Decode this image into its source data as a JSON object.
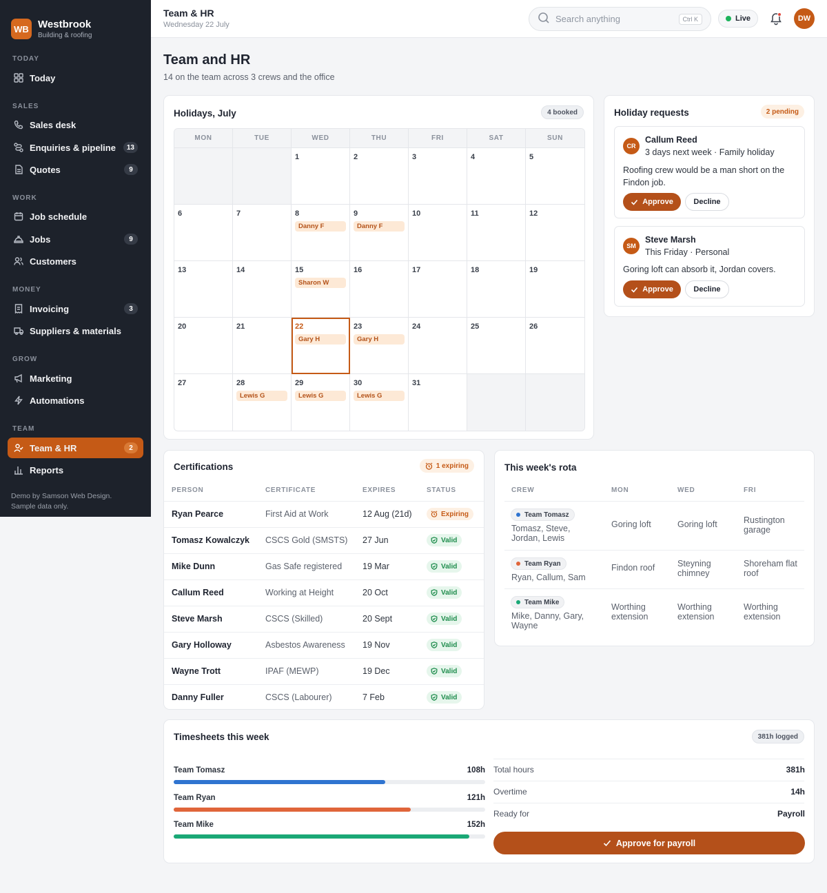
{
  "brand": {
    "logo": "WB",
    "name": "Westbrook",
    "subtitle": "Building & roofing"
  },
  "sidebar": {
    "sections": [
      "TODAY",
      "SALES",
      "WORK",
      "MONEY",
      "GROW",
      "TEAM"
    ],
    "items": [
      {
        "label": "Today",
        "icon": "grid-icon",
        "badge": ""
      },
      {
        "label": "Sales desk",
        "icon": "phone-icon",
        "badge": ""
      },
      {
        "label": "Enquiries & pipeline",
        "icon": "pipeline-icon",
        "badge": "13"
      },
      {
        "label": "Quotes",
        "icon": "document-icon",
        "badge": "9"
      },
      {
        "label": "Job schedule",
        "icon": "calendar-icon",
        "badge": ""
      },
      {
        "label": "Jobs",
        "icon": "hardhat-icon",
        "badge": "9"
      },
      {
        "label": "Customers",
        "icon": "users-icon",
        "badge": ""
      },
      {
        "label": "Invoicing",
        "icon": "receipt-icon",
        "badge": "3"
      },
      {
        "label": "Suppliers & materials",
        "icon": "truck-icon",
        "badge": ""
      },
      {
        "label": "Marketing",
        "icon": "megaphone-icon",
        "badge": ""
      },
      {
        "label": "Automations",
        "icon": "bolt-icon",
        "badge": ""
      },
      {
        "label": "Team & HR",
        "icon": "user-check-icon",
        "badge": "2"
      },
      {
        "label": "Reports",
        "icon": "bar-chart-icon",
        "badge": ""
      }
    ],
    "footer_line1": "Demo by Samson Web Design.",
    "footer_line2": "Sample data only."
  },
  "topbar": {
    "title": "Team & HR",
    "date": "Wednesday 22 July",
    "search_placeholder": "Search anything",
    "search_shortcut": "Ctrl K",
    "live_label": "Live",
    "avatar": "DW"
  },
  "page": {
    "title": "Team and HR",
    "subtitle": "14 on the team across 3 crews and the office"
  },
  "holidays": {
    "title": "Holidays, July",
    "badge": "4 booked",
    "weekdays": [
      "MON",
      "TUE",
      "WED",
      "THU",
      "FRI",
      "SAT",
      "SUN"
    ],
    "cells": [
      {
        "day": "",
        "events": []
      },
      {
        "day": "",
        "events": []
      },
      {
        "day": "1",
        "events": []
      },
      {
        "day": "2",
        "events": []
      },
      {
        "day": "3",
        "events": []
      },
      {
        "day": "4",
        "events": []
      },
      {
        "day": "5",
        "events": []
      },
      {
        "day": "6",
        "events": []
      },
      {
        "day": "7",
        "events": []
      },
      {
        "day": "8",
        "events": [
          "Danny F"
        ]
      },
      {
        "day": "9",
        "events": [
          "Danny F"
        ]
      },
      {
        "day": "10",
        "events": []
      },
      {
        "day": "11",
        "events": []
      },
      {
        "day": "12",
        "events": []
      },
      {
        "day": "13",
        "events": []
      },
      {
        "day": "14",
        "events": []
      },
      {
        "day": "15",
        "events": [
          "Sharon W"
        ]
      },
      {
        "day": "16",
        "events": []
      },
      {
        "day": "17",
        "events": []
      },
      {
        "day": "18",
        "events": []
      },
      {
        "day": "19",
        "events": []
      },
      {
        "day": "20",
        "events": []
      },
      {
        "day": "21",
        "events": []
      },
      {
        "day": "22",
        "events": [
          "Gary H"
        ],
        "today": true
      },
      {
        "day": "23",
        "events": [
          "Gary H"
        ]
      },
      {
        "day": "24",
        "events": []
      },
      {
        "day": "25",
        "events": []
      },
      {
        "day": "26",
        "events": []
      },
      {
        "day": "27",
        "events": []
      },
      {
        "day": "28",
        "events": [
          "Lewis G"
        ]
      },
      {
        "day": "29",
        "events": [
          "Lewis G"
        ]
      },
      {
        "day": "30",
        "events": [
          "Lewis G"
        ]
      },
      {
        "day": "31",
        "events": []
      },
      {
        "day": "",
        "events": []
      },
      {
        "day": "",
        "events": []
      }
    ]
  },
  "requests": {
    "title": "Holiday requests",
    "badge": "2 pending",
    "items": [
      {
        "initials": "CR",
        "name": "Callum Reed",
        "meta": "3 days next week · Family holiday",
        "note": "Roofing crew would be a man short on the Findon job.",
        "approve": "Approve",
        "decline": "Decline"
      },
      {
        "initials": "SM",
        "name": "Steve Marsh",
        "meta": "This Friday · Personal",
        "note": "Goring loft can absorb it, Jordan covers.",
        "approve": "Approve",
        "decline": "Decline"
      }
    ]
  },
  "certifications": {
    "title": "Certifications",
    "badge": "1 expiring",
    "columns": [
      "PERSON",
      "CERTIFICATE",
      "EXPIRES",
      "STATUS"
    ],
    "rows": [
      {
        "person": "Ryan Pearce",
        "cert": "First Aid at Work",
        "expires": "12 Aug (21d)",
        "status": "Expiring"
      },
      {
        "person": "Tomasz Kowalczyk",
        "cert": "CSCS Gold (SMSTS)",
        "expires": "27 Jun",
        "status": "Valid"
      },
      {
        "person": "Mike Dunn",
        "cert": "Gas Safe registered",
        "expires": "19 Mar",
        "status": "Valid"
      },
      {
        "person": "Callum Reed",
        "cert": "Working at Height",
        "expires": "20 Oct",
        "status": "Valid"
      },
      {
        "person": "Steve Marsh",
        "cert": "CSCS (Skilled)",
        "expires": "20 Sept",
        "status": "Valid"
      },
      {
        "person": "Gary Holloway",
        "cert": "Asbestos Awareness",
        "expires": "19 Nov",
        "status": "Valid"
      },
      {
        "person": "Wayne Trott",
        "cert": "IPAF (MEWP)",
        "expires": "19 Dec",
        "status": "Valid"
      },
      {
        "person": "Danny Fuller",
        "cert": "CSCS (Labourer)",
        "expires": "7 Feb",
        "status": "Valid"
      }
    ]
  },
  "rota": {
    "title": "This week's rota",
    "columns": [
      "CREW",
      "MON",
      "WED",
      "FRI"
    ],
    "rows": [
      {
        "team": "Team Tomasz",
        "color": "#2f74d0",
        "members": "Tomasz, Steve, Jordan, Lewis",
        "mon": "Goring loft",
        "wed": "Goring loft",
        "fri": "Rustington garage"
      },
      {
        "team": "Team Ryan",
        "color": "#e0653a",
        "members": "Ryan, Callum, Sam",
        "mon": "Findon roof",
        "wed": "Steyning chimney",
        "fri": "Shoreham flat roof"
      },
      {
        "team": "Team Mike",
        "color": "#1aa876",
        "members": "Mike, Danny, Gary, Wayne",
        "mon": "Worthing extension",
        "wed": "Worthing extension",
        "fri": "Worthing extension"
      }
    ]
  },
  "timesheets": {
    "title": "Timesheets this week",
    "badge": "381h logged",
    "teams": [
      {
        "name": "Team Tomasz",
        "hours": "108h",
        "fraction": 0.68,
        "color": "#2f74d0"
      },
      {
        "name": "Team Ryan",
        "hours": "121h",
        "fraction": 0.76,
        "color": "#e0653a"
      },
      {
        "name": "Team Mike",
        "hours": "152h",
        "fraction": 0.95,
        "color": "#1aa876"
      }
    ],
    "summary": [
      {
        "label": "Total hours",
        "value": "381h"
      },
      {
        "label": "Overtime",
        "value": "14h"
      },
      {
        "label": "Ready for",
        "value": "Payroll"
      }
    ],
    "approve_label": "Approve for payroll"
  }
}
